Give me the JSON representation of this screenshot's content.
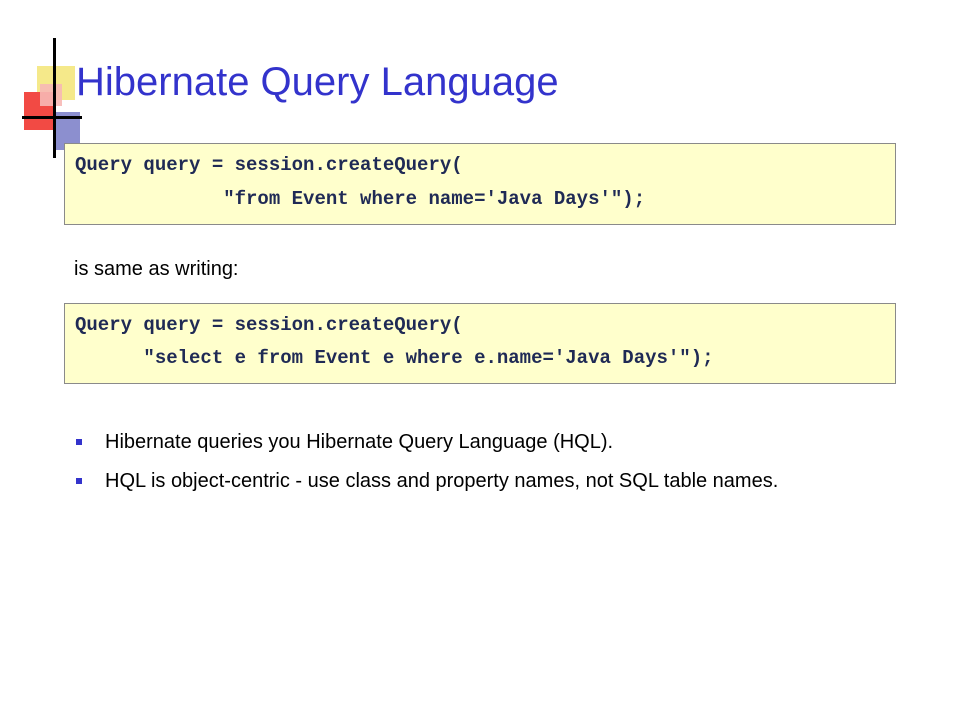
{
  "slide": {
    "title": "Hibernate Query Language",
    "code_block_1": {
      "line1": "Query query = session.createQuery(",
      "line2": "             \"from Event where name='Java Days'\");"
    },
    "separator_text": "is same as writing:",
    "code_block_2": {
      "line1": "Query query = session.createQuery(",
      "line2": "      \"select e from Event e where e.name='Java Days'\");"
    },
    "bullets": [
      {
        "text": "Hibernate queries you Hibernate Query Language (HQL)."
      },
      {
        "text": "HQL is object-centric - use class and property names, not SQL table names."
      }
    ]
  }
}
